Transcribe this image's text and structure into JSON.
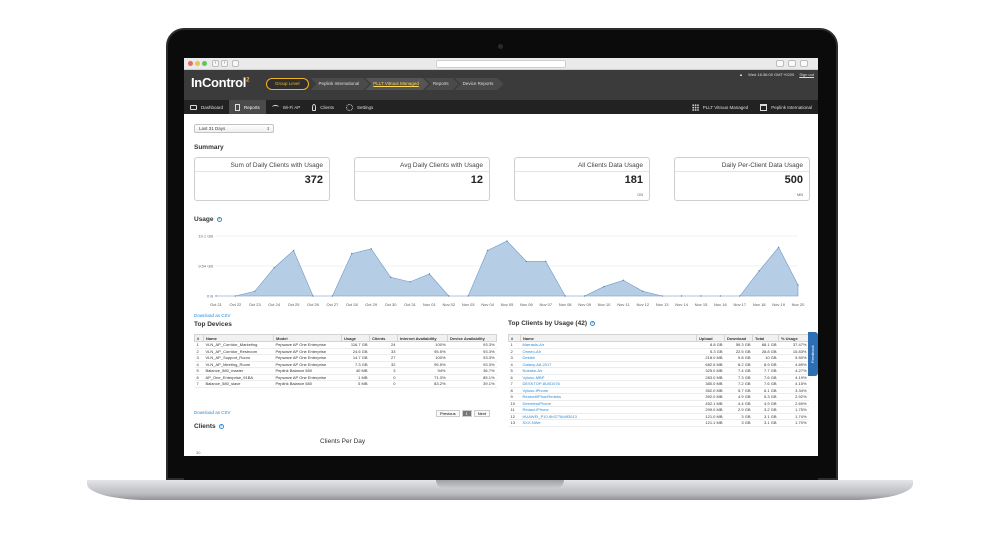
{
  "browser": {
    "nav_back": "‹",
    "nav_fwd": "›"
  },
  "header": {
    "logo": "InControl",
    "logo_sup": "2",
    "breadcrumbs": [
      "Group Level",
      "Peplink International",
      "PLLT Vitruus Managed",
      "Reports",
      "Device Reports"
    ],
    "timestamp": "Wed 16:36:00 GMT+0200",
    "signout": "Sign out"
  },
  "nav": {
    "items": [
      {
        "label": "Dashboard",
        "icon": "monitor-icon"
      },
      {
        "label": "Reports",
        "icon": "document-icon"
      },
      {
        "label": "Wi-Fi AP",
        "icon": "wifi-icon"
      },
      {
        "label": "Clients",
        "icon": "person-icon"
      },
      {
        "label": "Settings",
        "icon": "gear-icon"
      }
    ],
    "right_items": [
      {
        "label": "PLLT Vitruus Managed",
        "icon": "grid-icon"
      },
      {
        "label": "Peplink International",
        "icon": "org-icon"
      }
    ]
  },
  "filter": {
    "range": "Last 31 Days"
  },
  "summary": {
    "title": "Summary",
    "cards": [
      {
        "title": "Sum of Daily Clients with Usage",
        "value": "372",
        "unit": ""
      },
      {
        "title": "Avg Daily Clients with Usage",
        "value": "12",
        "unit": ""
      },
      {
        "title": "All Clients Data Usage",
        "value": "181",
        "unit": "GB"
      },
      {
        "title": "Daily Per-Client Data Usage",
        "value": "500",
        "unit": "MB"
      }
    ]
  },
  "usage": {
    "title": "Usage",
    "download_csv": "Download as CSV"
  },
  "chart_data": {
    "type": "area",
    "title": "",
    "xlabel": "",
    "ylabel": "",
    "y_ticks": [
      "0 B",
      "9.54 GB",
      "19.1 GB"
    ],
    "ylim": [
      0,
      19.1
    ],
    "x": [
      "Oct 21",
      "Oct 22",
      "Oct 23",
      "Oct 24",
      "Oct 25",
      "Oct 26",
      "Oct 27",
      "Oct 28",
      "Oct 29",
      "Oct 30",
      "Oct 31",
      "Nov 01",
      "Nov 02",
      "Nov 03",
      "Nov 04",
      "Nov 05",
      "Nov 06",
      "Nov 07",
      "Nov 08",
      "Nov 09",
      "Nov 10",
      "Nov 11",
      "Nov 12",
      "Nov 13",
      "Nov 14",
      "Nov 15",
      "Nov 16",
      "Nov 17",
      "Nov 18",
      "Nov 19",
      "Nov 20"
    ],
    "series": [
      {
        "name": "",
        "color": "#a9c4e2",
        "values": [
          0,
          0,
          1.5,
          9,
          14.5,
          0,
          0,
          13.5,
          15,
          6,
          4.5,
          7,
          0,
          0,
          14.5,
          17.5,
          11,
          11,
          0,
          0,
          3,
          5,
          1.5,
          0,
          0,
          0,
          0,
          0,
          8,
          15.5,
          3.5
        ]
      }
    ],
    "grid": true
  },
  "top_devices": {
    "title": "Top Devices",
    "columns": [
      "#",
      "Name",
      "Model",
      "Usage",
      "Clients",
      "Internet Availability",
      "Device Availability"
    ],
    "rows": [
      [
        "1",
        "VLN_AP_Corridor_Marketing",
        "Pepwave AP One Enterprise",
        "116.7 GB",
        "24",
        "100%",
        "93.3%"
      ],
      [
        "2",
        "VLN_AP_Corridor_Restroom",
        "Pepwave AP One Enterprise",
        "24.6 GB",
        "33",
        "95.5%",
        "93.3%"
      ],
      [
        "3",
        "VLN_AP_Support_Room",
        "Pepwave AP One Enterprise",
        "14.7 GB",
        "27",
        "100%",
        "93.3%"
      ],
      [
        "4",
        "VLN_AP_Meeting_Room",
        "Pepwave AP One Enterprise",
        "7.3 GB",
        "32",
        "95.5%",
        "93.3%"
      ],
      [
        "5",
        "Balance_580_master",
        "Peplink Balance 580",
        "40 MB",
        "3",
        "94%",
        "36.7%"
      ],
      [
        "6",
        "AP_One_Enterprise_91BA",
        "Pepwave AP One Enterprise",
        "1 MB",
        "0",
        "71.3%",
        "85.1%"
      ],
      [
        "7",
        "Balance_580_slave",
        "Peplink Balance 580",
        "5 MB",
        "0",
        "83.2%",
        "39.1%"
      ]
    ],
    "download_csv": "Download as CSV",
    "pager": {
      "prev": "Previous",
      "page": "1",
      "next": "Next"
    }
  },
  "top_clients": {
    "title": "Top Clients by Usage (42)",
    "columns": [
      "#",
      "Name",
      "Upload",
      "Download",
      "Total",
      "% Usage"
    ],
    "rows": [
      [
        "1",
        "Marrasis-Air",
        "8.8 GB",
        "59.3 GB",
        "68.1 GB",
        "37.47%"
      ],
      [
        "2",
        "Ormeo-Air",
        "5.3 GB",
        "22.5 GB",
        "28.8 GB",
        "15.83%"
      ],
      [
        "3",
        "Dektek",
        "218.0 MB",
        "9.8 GB",
        "10 GB",
        "5.50%"
      ],
      [
        "4",
        "Galaxy-A8-2017",
        "682.5 MB",
        "8.2 GB",
        "8.9 GB",
        "4.89%"
      ],
      [
        "5",
        "Nokase-Air",
        "325.0 MB",
        "7.4 GB",
        "7.7 GB",
        "4.27%"
      ],
      [
        "6",
        "Vyloso-MBP",
        "283.0 MB",
        "7.3 GB",
        "7.6 GB",
        "4.19%"
      ],
      [
        "7",
        "DESKTOP-8U0D078",
        "380.0 MB",
        "7.2 GB",
        "7.6 GB",
        "4.15%"
      ],
      [
        "8",
        "Vyloso-iPhone",
        "352.0 MB",
        "5.7 GB",
        "6.1 GB",
        "3.34%"
      ],
      [
        "9",
        "ReahmBPhonRedeks",
        "392.0 MB",
        "4.9 GB",
        "5.3 GB",
        "2.92%"
      ],
      [
        "10",
        "DeemessPhone",
        "452.1 MB",
        "4.4 GB",
        "4.9 GB",
        "2.69%"
      ],
      [
        "11",
        "Redaxi-iPhone",
        "299.0 MB",
        "2.9 GB",
        "3.2 GB",
        "1.75%"
      ],
      [
        "12",
        "HUAWEI_P10-9b3778d4f3013",
        "121.0 MB",
        "3 GB",
        "3.1 GB",
        "1.74%"
      ],
      [
        "13",
        "SXX-NWe",
        "121.1 MB",
        "3 GB",
        "3.1 GB",
        "1.70%"
      ]
    ]
  },
  "clients": {
    "title": "Clients",
    "chart_title": "Clients Per Day",
    "y_tick_top": "30"
  },
  "feedback": {
    "label": "Feedback"
  }
}
